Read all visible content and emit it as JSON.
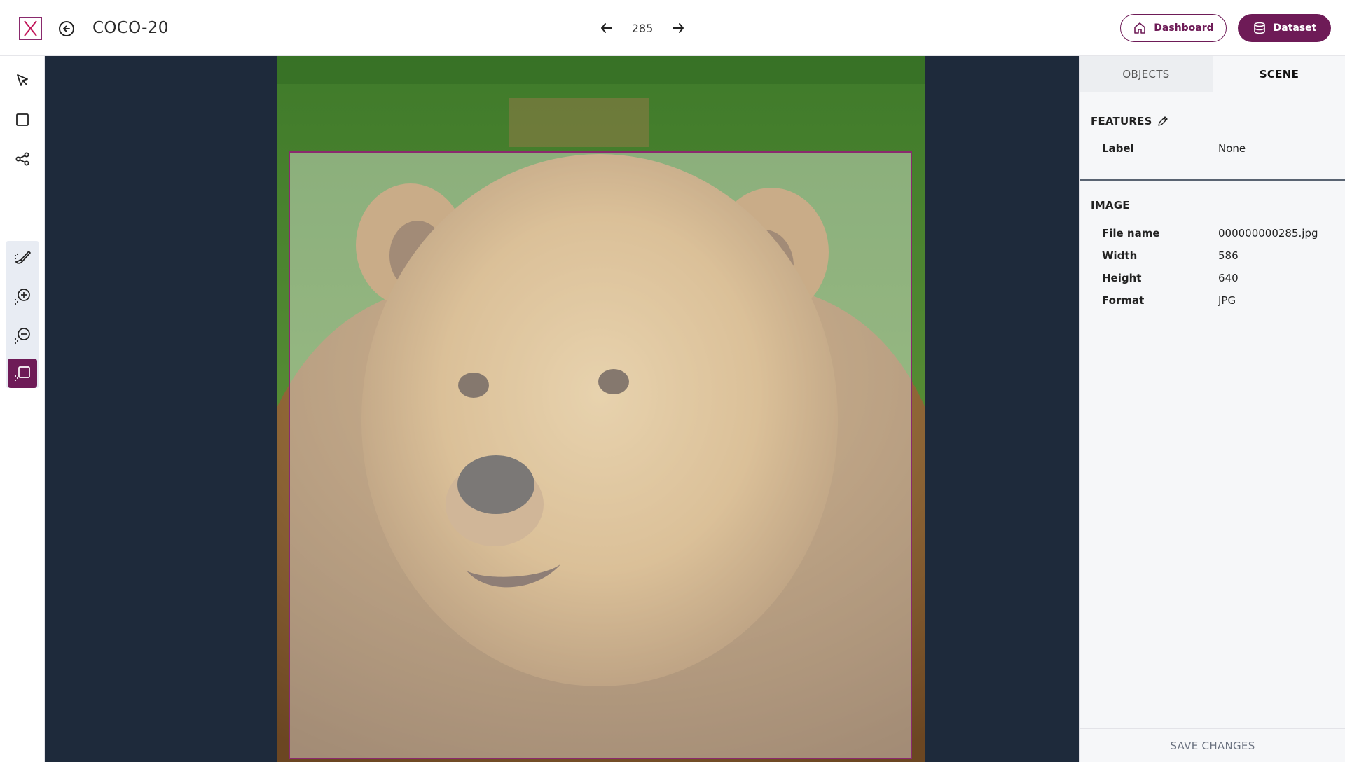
{
  "header": {
    "title": "COCO-20",
    "page_number": "285",
    "dashboard_label": "Dashboard",
    "dataset_label": "Dataset"
  },
  "toolbar": {
    "tools": [
      "select-tool",
      "bbox-tool",
      "keypoint-tool",
      "smart-brush-tool",
      "smart-add-tool",
      "smart-remove-tool",
      "smart-bbox-tool"
    ],
    "active_tool": "smart-bbox-tool"
  },
  "panel": {
    "tabs": [
      {
        "label": "OBJECTS",
        "active": false
      },
      {
        "label": "SCENE",
        "active": true
      }
    ],
    "features": {
      "title": "FEATURES",
      "rows": [
        {
          "key": "Label",
          "value": "None"
        }
      ]
    },
    "image": {
      "title": "IMAGE",
      "rows": [
        {
          "key": "File name",
          "value": "000000000285.jpg"
        },
        {
          "key": "Width",
          "value": "586"
        },
        {
          "key": "Height",
          "value": "640"
        },
        {
          "key": "Format",
          "value": "JPG"
        }
      ]
    },
    "save_label": "SAVE CHANGES"
  },
  "colors": {
    "accent": "#6e1b57",
    "canvas_bg": "#1e2a3b",
    "bbox": "#8a2a6d"
  }
}
